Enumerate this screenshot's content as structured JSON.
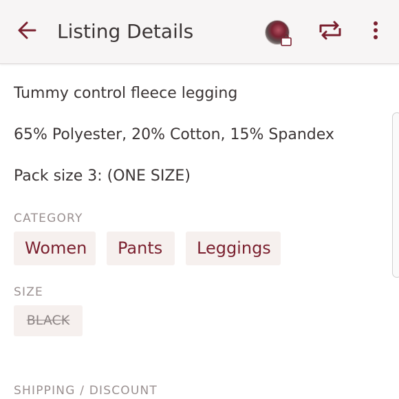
{
  "header": {
    "title": "Listing Details",
    "accent_color": "#7a1f2e"
  },
  "icons": {
    "back": "arrow-left-icon",
    "avatar": "avatar",
    "bag": "shopping-bag-icon",
    "repost": "repost-icon",
    "more": "more-vertical-icon"
  },
  "description": {
    "lines": [
      "Tummy control fleece legging",
      "65% Polyester, 20% Cotton, 15% Spandex",
      "Pack size 3: (ONE SIZE)"
    ]
  },
  "category": {
    "label": "CATEGORY",
    "chips": [
      "Women",
      "Pants",
      "Leggings"
    ]
  },
  "size": {
    "label": "SIZE",
    "value": "BLACK"
  },
  "shipping": {
    "label": "SHIPPING / DISCOUNT"
  }
}
